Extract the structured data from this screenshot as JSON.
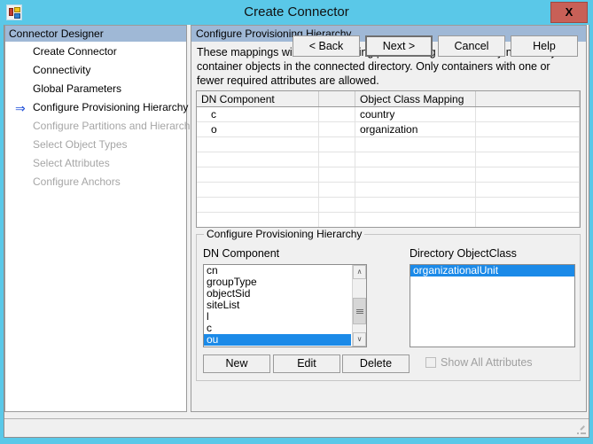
{
  "window": {
    "title": "Create Connector",
    "icon": "app-icon",
    "close_label": "X"
  },
  "sidebar": {
    "header": "Connector Designer",
    "items": [
      {
        "label": "Create Connector",
        "state": "enabled",
        "current": false
      },
      {
        "label": "Connectivity",
        "state": "enabled",
        "current": false
      },
      {
        "label": "Global Parameters",
        "state": "enabled",
        "current": false
      },
      {
        "label": "Configure Provisioning Hierarchy",
        "state": "enabled",
        "current": true
      },
      {
        "label": "Configure Partitions and Hierarchies",
        "state": "disabled",
        "current": false
      },
      {
        "label": "Select Object Types",
        "state": "disabled",
        "current": false
      },
      {
        "label": "Select Attributes",
        "state": "disabled",
        "current": false
      },
      {
        "label": "Configure Anchors",
        "state": "disabled",
        "current": false
      }
    ],
    "current_arrow": "⇒"
  },
  "content": {
    "header": "Configure Provisioning Hierarchy",
    "description": "These mappings will be used during provisioning to create any necessary container objects in the connected directory.  Only containers with one or fewer required attributes are allowed.",
    "grid": {
      "columns": [
        "DN Component",
        "",
        "Object Class Mapping",
        ""
      ],
      "rows": [
        {
          "dn": "c",
          "blank": "",
          "mapping": "country",
          "extra": ""
        },
        {
          "dn": "o",
          "blank": "",
          "mapping": "organization",
          "extra": ""
        },
        {
          "dn": "",
          "blank": "",
          "mapping": "",
          "extra": ""
        },
        {
          "dn": "",
          "blank": "",
          "mapping": "",
          "extra": ""
        },
        {
          "dn": "",
          "blank": "",
          "mapping": "",
          "extra": ""
        },
        {
          "dn": "",
          "blank": "",
          "mapping": "",
          "extra": ""
        },
        {
          "dn": "",
          "blank": "",
          "mapping": "",
          "extra": ""
        },
        {
          "dn": "",
          "blank": "",
          "mapping": "",
          "extra": ""
        },
        {
          "dn": "",
          "blank": "",
          "mapping": "",
          "extra": ""
        }
      ]
    },
    "groupbox": {
      "title": "Configure Provisioning Hierarchy",
      "dn_label": "DN Component",
      "objectclass_label": "Directory ObjectClass",
      "dn_items": [
        {
          "label": "cn",
          "selected": false
        },
        {
          "label": "groupType",
          "selected": false
        },
        {
          "label": "objectSid",
          "selected": false
        },
        {
          "label": "siteList",
          "selected": false
        },
        {
          "label": "l",
          "selected": false
        },
        {
          "label": "c",
          "selected": false
        },
        {
          "label": "ou",
          "selected": true
        }
      ],
      "objectclass_items": [
        {
          "label": "organizationalUnit",
          "selected": true
        }
      ],
      "buttons": {
        "new": "New",
        "edit": "Edit",
        "delete": "Delete"
      },
      "checkbox": {
        "label": "Show All Attributes",
        "checked": false,
        "enabled": false
      },
      "scrollbar": {
        "up": "∧",
        "down": "∨"
      }
    }
  },
  "footer": {
    "back": "< Back",
    "next": "Next  >",
    "cancel": "Cancel",
    "help": "Help"
  },
  "colors": {
    "titlebar": "#5ac8e8",
    "section_header": "#9fb8d6",
    "selection": "#1b8ae8",
    "close_button": "#c86057",
    "arrow": "#1f4fd8",
    "disabled_text": "#a6a6a6"
  }
}
